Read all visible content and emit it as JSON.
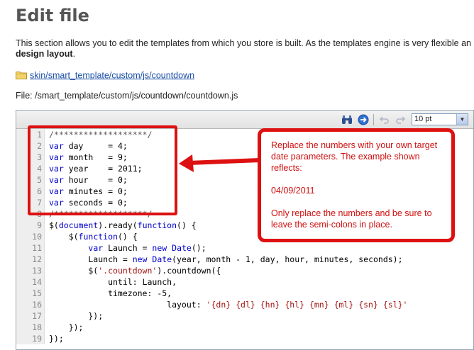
{
  "page": {
    "title": "Edit file",
    "description_line1": "This section allows you to edit the templates from which you store is built. As the templates engine is very flexible an",
    "description_line2_bold": "design layout",
    "description_line2_rest": ".",
    "path_link": "skin/smart_template/custom/js/countdown",
    "file_label": "File: ",
    "file_path": "/smart_template/custom/js/countdown/countdown.js"
  },
  "toolbar": {
    "icons": [
      "binoculars-icon",
      "goto-icon",
      "undo-icon",
      "redo-icon"
    ],
    "font_size": "10 pt"
  },
  "code_lines": [
    {
      "n": "1",
      "t": "/*******************/"
    },
    {
      "n": "2",
      "t": "var day     = 4;"
    },
    {
      "n": "3",
      "t": "var month   = 9;"
    },
    {
      "n": "4",
      "t": "var year    = 2011;"
    },
    {
      "n": "5",
      "t": "var hour    = 0;"
    },
    {
      "n": "6",
      "t": "var minutes = 0;"
    },
    {
      "n": "7",
      "t": "var seconds = 0;"
    },
    {
      "n": "8",
      "t": "/*******************/"
    },
    {
      "n": "9",
      "t": "$(document).ready(function() {"
    },
    {
      "n": "10",
      "t": "    $(function() {"
    },
    {
      "n": "11",
      "t": "        var Launch = new Date();"
    },
    {
      "n": "12",
      "t": "        Launch = new Date(year, month - 1, day, hour, minutes, seconds);"
    },
    {
      "n": "13",
      "t": "        $('.countdown').countdown({"
    },
    {
      "n": "14",
      "t": "            until: Launch,"
    },
    {
      "n": "15",
      "t": "            timezone: -5,"
    },
    {
      "n": "16",
      "t": "                        layout: '{dn} {dl} {hn} {hl} {mn} {ml} {sn} {sl}'"
    },
    {
      "n": "17",
      "t": "        });"
    },
    {
      "n": "18",
      "t": "    });"
    },
    {
      "n": "19",
      "t": "});"
    }
  ],
  "callout": {
    "p1": "Replace the numbers with your own target date parameters. The example shown reflects:",
    "p2": "04/09/2011",
    "p3": "Only replace the numbers and be sure to leave the semi-colons in place."
  },
  "colors": {
    "annotation_red": "#dd1111",
    "link_blue": "#1a4fa6",
    "keyword_blue": "#0000cc",
    "string_red": "#a31515"
  }
}
